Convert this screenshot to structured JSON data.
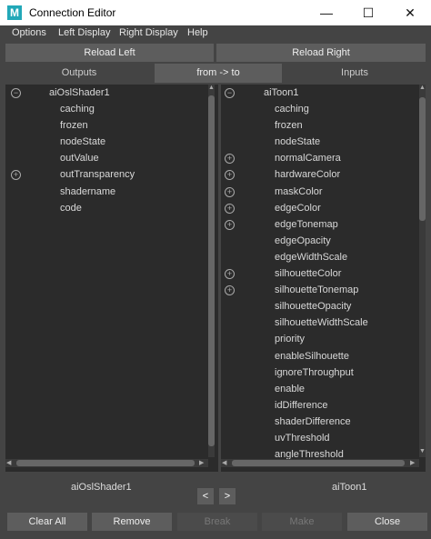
{
  "window": {
    "title": "Connection Editor",
    "app_icon": "M",
    "minimize": "—",
    "maximize": "☐",
    "close": "✕"
  },
  "menu": [
    "Options",
    "Left Display",
    "Right Display",
    "Help"
  ],
  "reload": {
    "left": "Reload Left",
    "right": "Reload Right"
  },
  "tabs": {
    "outputs": "Outputs",
    "direction": "from -> to",
    "inputs": "Inputs"
  },
  "left_panel": {
    "node": "aiOslShader1",
    "attributes": [
      {
        "label": "caching",
        "expandable": false
      },
      {
        "label": "frozen",
        "expandable": false
      },
      {
        "label": "nodeState",
        "expandable": false
      },
      {
        "label": "outValue",
        "expandable": false
      },
      {
        "label": "outTransparency",
        "expandable": true
      },
      {
        "label": "shadername",
        "expandable": false
      },
      {
        "label": "code",
        "expandable": false
      }
    ]
  },
  "right_panel": {
    "node": "aiToon1",
    "attributes": [
      {
        "label": "caching",
        "expandable": false
      },
      {
        "label": "frozen",
        "expandable": false
      },
      {
        "label": "nodeState",
        "expandable": false
      },
      {
        "label": "normalCamera",
        "expandable": true
      },
      {
        "label": "hardwareColor",
        "expandable": true
      },
      {
        "label": "maskColor",
        "expandable": true
      },
      {
        "label": "edgeColor",
        "expandable": true
      },
      {
        "label": "edgeTonemap",
        "expandable": true
      },
      {
        "label": "edgeOpacity",
        "expandable": false
      },
      {
        "label": "edgeWidthScale",
        "expandable": false
      },
      {
        "label": "silhouetteColor",
        "expandable": true
      },
      {
        "label": "silhouetteTonemap",
        "expandable": true
      },
      {
        "label": "silhouetteOpacity",
        "expandable": false
      },
      {
        "label": "silhouetteWidthScale",
        "expandable": false
      },
      {
        "label": "priority",
        "expandable": false
      },
      {
        "label": "enableSilhouette",
        "expandable": false
      },
      {
        "label": "ignoreThroughput",
        "expandable": false
      },
      {
        "label": "enable",
        "expandable": false
      },
      {
        "label": "idDifference",
        "expandable": false
      },
      {
        "label": "shaderDifference",
        "expandable": false
      },
      {
        "label": "uvThreshold",
        "expandable": false
      },
      {
        "label": "angleThreshold",
        "expandable": false
      }
    ]
  },
  "footer": {
    "left_node": "aiOslShader1",
    "right_node": "aiToon1",
    "prev": "<",
    "next": ">",
    "buttons": [
      {
        "label": "Clear All",
        "enabled": true
      },
      {
        "label": "Remove",
        "enabled": true
      },
      {
        "label": "Break",
        "enabled": false
      },
      {
        "label": "Make",
        "enabled": false
      },
      {
        "label": "Close",
        "enabled": true
      }
    ]
  }
}
